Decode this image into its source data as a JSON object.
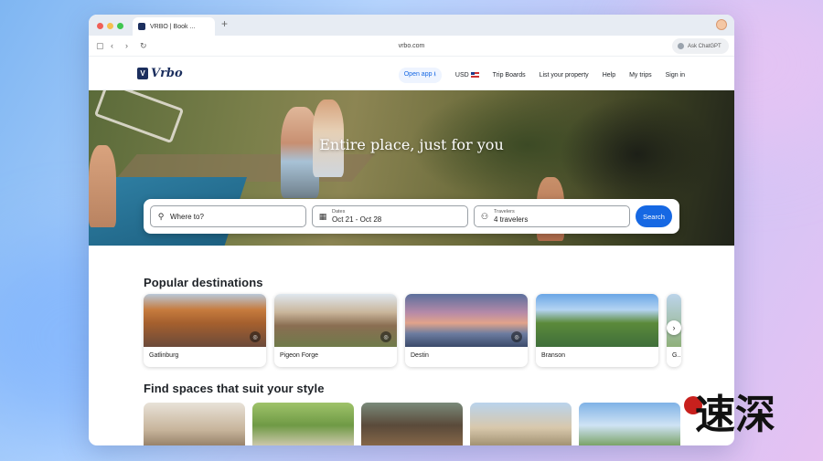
{
  "browser": {
    "tab_title": "VRBO | Book ...",
    "new_tab": "+",
    "url": "vrbo.com",
    "ask_chatgpt": "Ask ChatGPT",
    "colors": {
      "close": "#f05f57",
      "min": "#f5bf4f",
      "max": "#3fc650"
    }
  },
  "site": {
    "logo_text": "Vrbo",
    "nav": {
      "open_app": "Open app ⭳",
      "currency": "USD",
      "trip_boards": "Trip Boards",
      "list_property": "List your property",
      "help": "Help",
      "my_trips": "My trips",
      "sign_in": "Sign in"
    },
    "accent": "#1668e3",
    "brand": "#1c2f5e"
  },
  "hero": {
    "title": "Entire place, just for you"
  },
  "search": {
    "where_placeholder": "Where to?",
    "dates_label": "Dates",
    "dates_value": "Oct 21 - Oct 28",
    "travelers_label": "Travelers",
    "travelers_value": "4 travelers",
    "button": "Search"
  },
  "popular": {
    "heading": "Popular destinations",
    "items": [
      {
        "name": "Gatlinburg"
      },
      {
        "name": "Pigeon Forge"
      },
      {
        "name": "Destin"
      },
      {
        "name": "Branson"
      },
      {
        "name": "G..."
      }
    ]
  },
  "styles": {
    "heading": "Find spaces that suit your style"
  },
  "watermark": {
    "text": "速深"
  }
}
